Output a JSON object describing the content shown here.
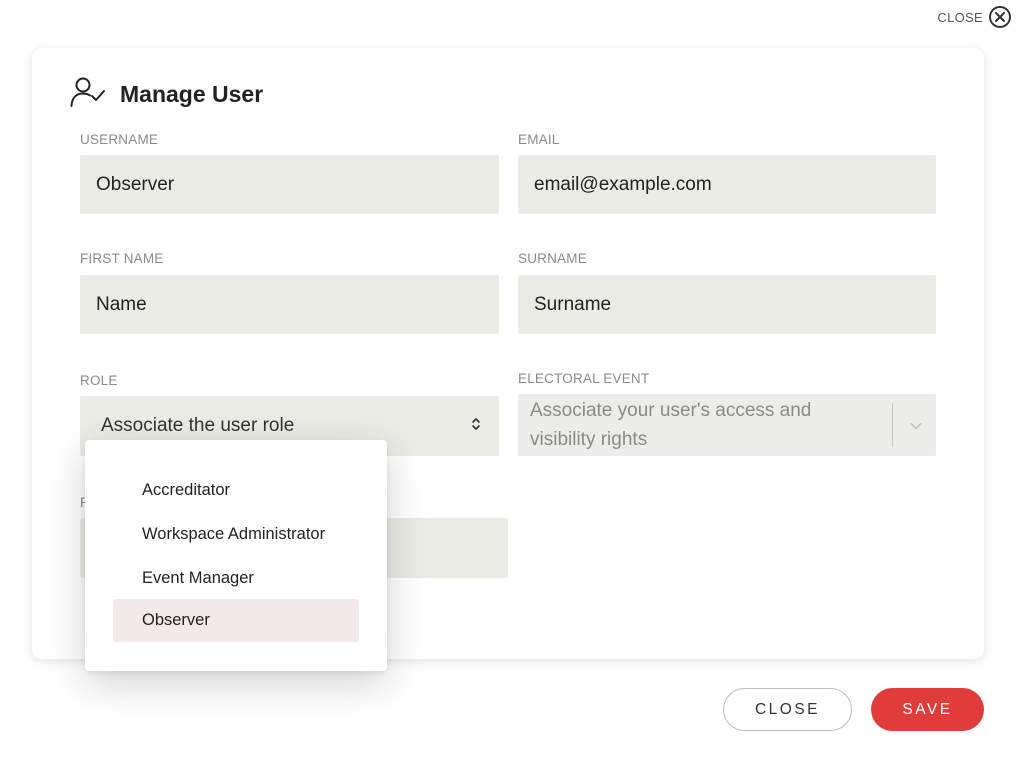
{
  "header": {
    "close_label": "CLOSE"
  },
  "modal": {
    "title": "Manage User",
    "fields": {
      "username": {
        "label": "USERNAME",
        "value": "Observer"
      },
      "email": {
        "label": "EMAIL",
        "value": "email@example.com"
      },
      "first_name": {
        "label": "FIRST NAME",
        "value": "Name"
      },
      "surname": {
        "label": "SURNAME",
        "value": "Surname"
      },
      "role": {
        "label": "ROLE",
        "placeholder": "Associate the user role"
      },
      "electoral_event": {
        "label": "ELECTORAL EVENT",
        "placeholder_line1": "Associate your user's access and",
        "placeholder_line2": "visibility rights"
      },
      "hidden_label_partial": "P"
    }
  },
  "role_dropdown": {
    "options": [
      "Accreditator",
      "Workspace Administrator",
      "Event Manager",
      "Observer"
    ],
    "selected": "Observer"
  },
  "footer": {
    "close_label": "CLOSE",
    "save_label": "SAVE"
  },
  "colors": {
    "accent": "#e03c3c",
    "input_bg": "#ebebe6",
    "selected_option_bg": "#f3e9e8"
  },
  "icons": [
    "close-circle-icon",
    "user-check-icon",
    "chevron-up-down-icon",
    "chevron-down-icon"
  ]
}
